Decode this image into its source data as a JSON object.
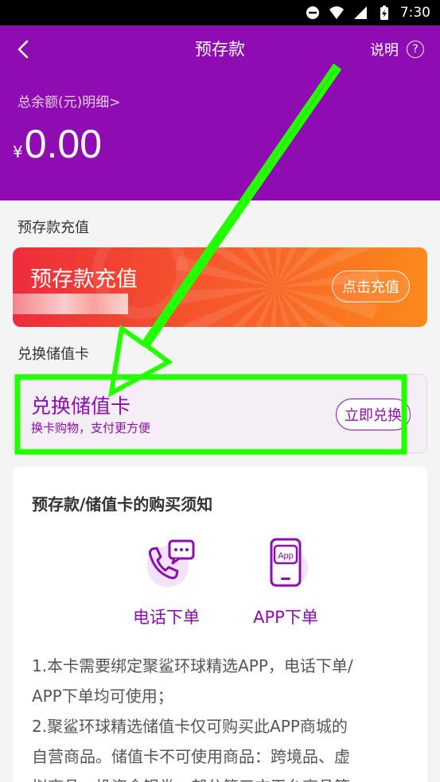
{
  "status_bar": {
    "time": "7:30",
    "icons": [
      "dnd-icon",
      "wifi-icon",
      "signal-icon",
      "battery-charging-icon"
    ]
  },
  "header": {
    "title": "预存款",
    "help_label": "说明",
    "help_icon": "question-circle-icon",
    "balance_link": "总余额(元)明细>",
    "currency": "¥",
    "balance": "0.00"
  },
  "recharge_section": {
    "label": "预存款充值",
    "card_title": "预存款充值",
    "button": "点击充值"
  },
  "redeem_section": {
    "label": "兑换储值卡",
    "card_title": "兑换储值卡",
    "card_subtitle": "换卡购物，支付更方便",
    "button": "立即兑换"
  },
  "notice": {
    "title": "预存款/储值卡的购买须知",
    "options": [
      {
        "label": "电话下单",
        "icon": "phone-chat-icon"
      },
      {
        "label": "APP下单",
        "icon": "app-phone-icon",
        "icon_text": "App"
      }
    ],
    "lines": [
      "1.本卡需要绑定聚鲨环球精选APP，电话下单/",
      "APP下单均可使用；",
      "2.聚鲨环球精选储值卡仅可购买此APP商城的",
      "自营商品。储值卡不可使用商品：跨境品、虚",
      "拟商品、投资金银类、部分第三方平台商品等"
    ]
  },
  "colors": {
    "brand_purple": "#8f0cb2",
    "annotation_green": "#22ff00"
  }
}
